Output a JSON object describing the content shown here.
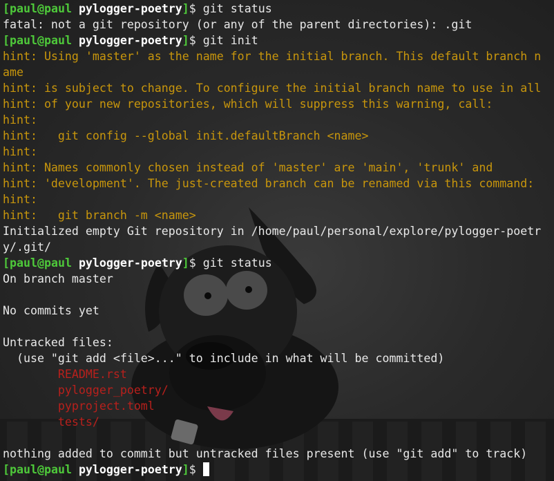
{
  "prompt": {
    "user": "paul",
    "host": "paul",
    "dir": "pylogger-poetry"
  },
  "lines": [
    {
      "type": "prompt",
      "cmd": "git status"
    },
    {
      "type": "out",
      "text": "fatal: not a git repository (or any of the parent directories): .git"
    },
    {
      "type": "prompt",
      "cmd": "git init"
    },
    {
      "type": "hint",
      "text": "hint: Using 'master' as the name for the initial branch. This default branch n"
    },
    {
      "type": "hint",
      "text": "ame"
    },
    {
      "type": "hint",
      "text": "hint: is subject to change. To configure the initial branch name to use in all"
    },
    {
      "type": "hint",
      "text": "hint: of your new repositories, which will suppress this warning, call:"
    },
    {
      "type": "hint",
      "text": "hint:"
    },
    {
      "type": "hint",
      "text": "hint:   git config --global init.defaultBranch <name>"
    },
    {
      "type": "hint",
      "text": "hint:"
    },
    {
      "type": "hint",
      "text": "hint: Names commonly chosen instead of 'master' are 'main', 'trunk' and"
    },
    {
      "type": "hint",
      "text": "hint: 'development'. The just-created branch can be renamed via this command:"
    },
    {
      "type": "hint",
      "text": "hint:"
    },
    {
      "type": "hint",
      "text": "hint:   git branch -m <name>"
    },
    {
      "type": "out",
      "text": "Initialized empty Git repository in /home/paul/personal/explore/pylogger-poetr"
    },
    {
      "type": "out",
      "text": "y/.git/"
    },
    {
      "type": "prompt",
      "cmd": "git status"
    },
    {
      "type": "out",
      "text": "On branch master"
    },
    {
      "type": "out",
      "text": ""
    },
    {
      "type": "out",
      "text": "No commits yet"
    },
    {
      "type": "out",
      "text": ""
    },
    {
      "type": "out",
      "text": "Untracked files:"
    },
    {
      "type": "out",
      "text": "  (use \"git add <file>...\" to include in what will be committed)"
    },
    {
      "type": "untracked",
      "text": "        README.rst"
    },
    {
      "type": "untracked",
      "text": "        pylogger_poetry/"
    },
    {
      "type": "untracked",
      "text": "        pyproject.toml"
    },
    {
      "type": "untracked",
      "text": "        tests/"
    },
    {
      "type": "out",
      "text": ""
    },
    {
      "type": "out",
      "text": "nothing added to commit but untracked files present (use \"git add\" to track)"
    },
    {
      "type": "prompt",
      "cmd": "",
      "cursor": true
    }
  ],
  "colors": {
    "prompt_green": "#4ec93a",
    "hint_yellow": "#c8960c",
    "untracked_red": "#b8201c",
    "text": "#e8e8e8"
  }
}
